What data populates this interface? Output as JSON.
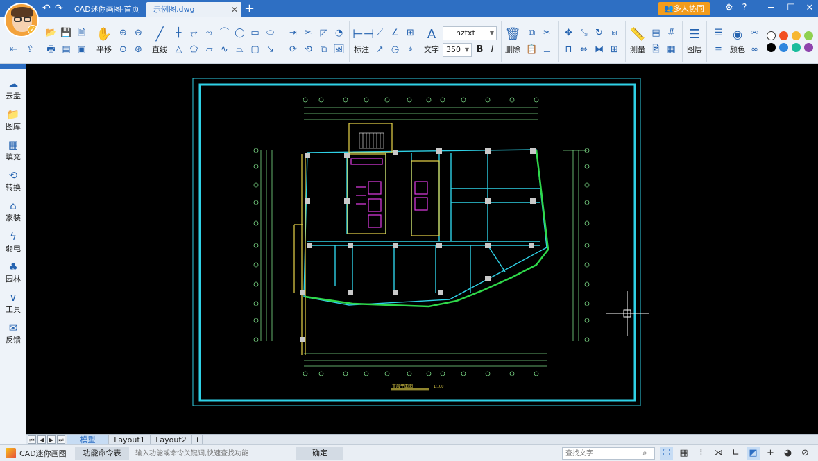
{
  "titlebar": {
    "home_tab": "CAD迷你画图-首页",
    "doc_tab": "示例图.dwg",
    "close_glyph": "✕",
    "add_glyph": "+",
    "collab_button": "多人协同",
    "undo_icon": "undo-icon",
    "redo_icon": "redo-icon"
  },
  "ribbon": {
    "pan_label": "平移",
    "line_label": "直线",
    "dim_label": "标注",
    "text_label": "文字",
    "font_name": "hztxt",
    "font_size": "350",
    "bold_label": "B",
    "italic_label": "I",
    "delete_label": "删除",
    "measure_label": "测量",
    "layer_label": "图层",
    "color_label": "颜色",
    "colors": [
      "#ffffff",
      "#f25022",
      "#f7b731",
      "#8fd14f",
      "#000000",
      "#2e86de",
      "#1abc9c",
      "#8e44ad"
    ]
  },
  "sidebar": {
    "items": [
      {
        "label": "云盘",
        "icon": "cloud-icon"
      },
      {
        "label": "图库",
        "icon": "folder-icon"
      },
      {
        "label": "填充",
        "icon": "hatch-icon"
      },
      {
        "label": "转换",
        "icon": "convert-icon"
      },
      {
        "label": "家装",
        "icon": "home-icon"
      },
      {
        "label": "弱电",
        "icon": "lightning-icon"
      },
      {
        "label": "园林",
        "icon": "tree-icon"
      },
      {
        "label": "工具",
        "icon": "tools-icon"
      },
      {
        "label": "反馈",
        "icon": "mail-icon"
      }
    ]
  },
  "drawing": {
    "title": "首层平面图",
    "scale": "1:100"
  },
  "layouts": {
    "tabs": [
      "模型",
      "Layout1",
      "Layout2"
    ],
    "active": "模型",
    "add_glyph": "+"
  },
  "statusbar": {
    "app_name": "CAD迷你画图",
    "cmd_table": "功能命令表",
    "cmd_placeholder": "输入功能或命令关键词,快速查找功能",
    "ok_button": "确定",
    "search_placeholder": "查找文字"
  }
}
